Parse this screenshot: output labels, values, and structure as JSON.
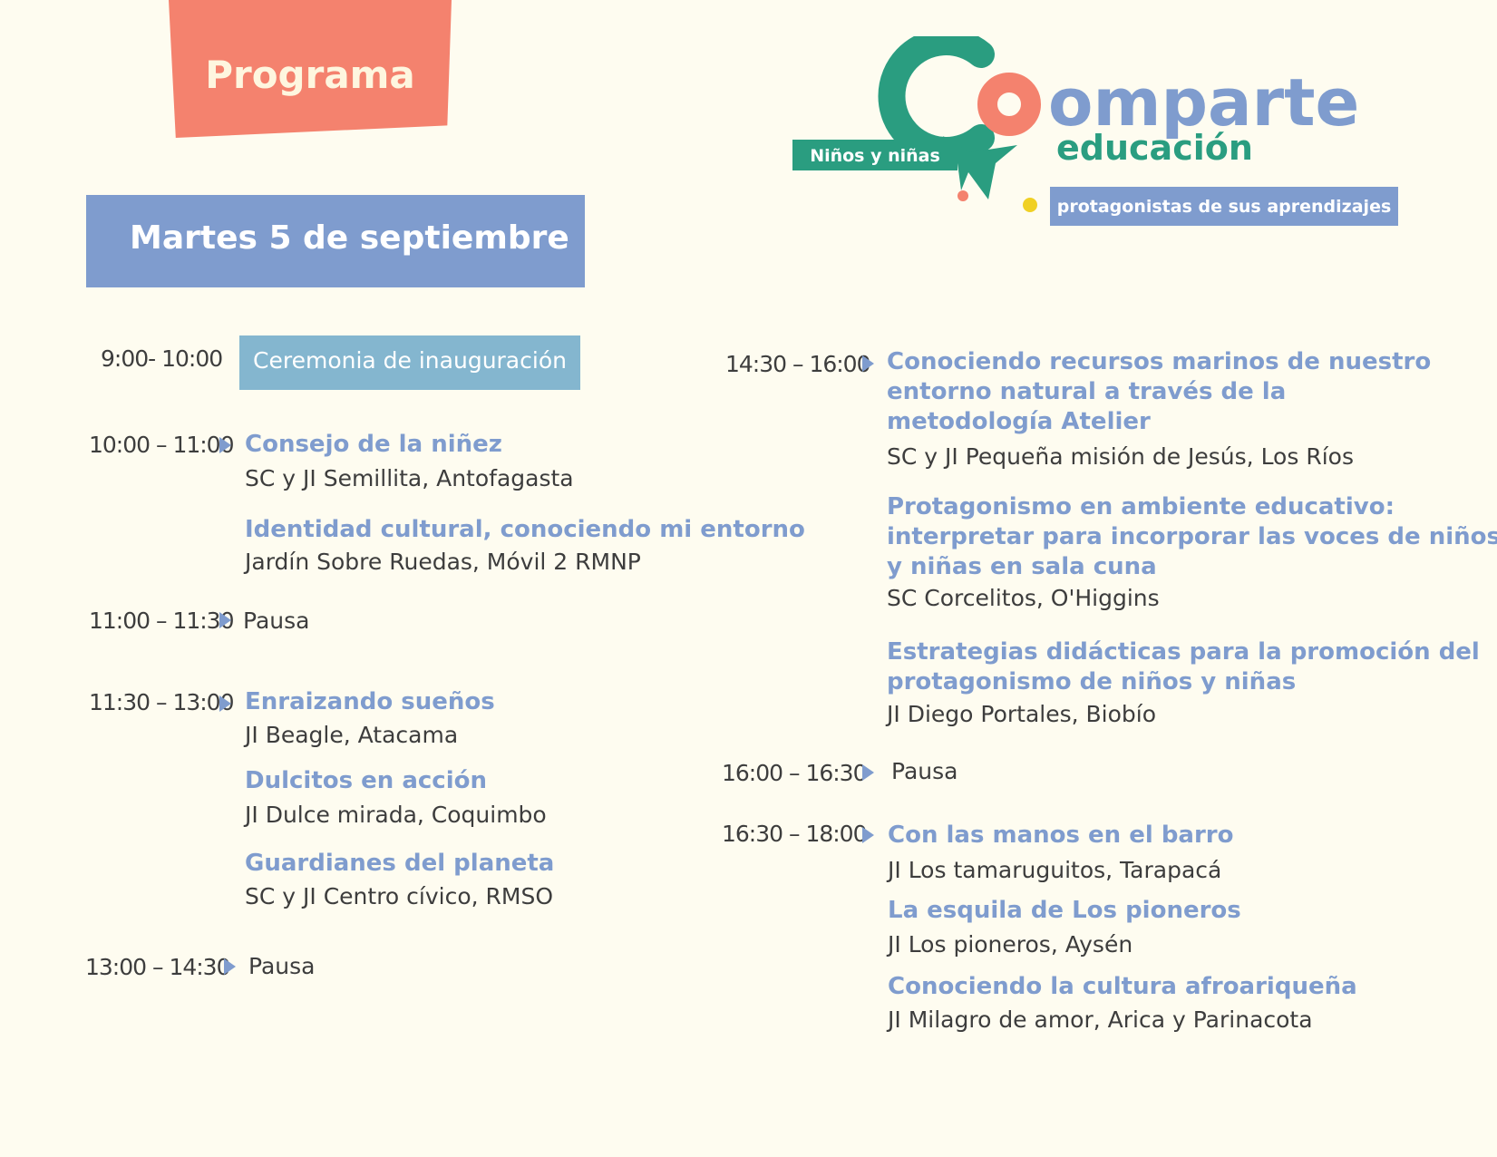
{
  "header": {
    "programa": "Programa",
    "date": "Martes 5 de septiembre"
  },
  "logo": {
    "word_main": "omparte",
    "letter_c": "C",
    "word_educacion": "educación",
    "tag_left": "Niños y niñas",
    "tag_right": "protagonistas de sus aprendizajes",
    "colors": {
      "teal": "#2a9d80",
      "coral": "#f4826e",
      "blue": "#7f9cce",
      "yellow": "#f0d024"
    }
  },
  "schedule_left": {
    "s1": {
      "time": "9:00- 10:00",
      "title": "Ceremonia de inauguración"
    },
    "s2": {
      "time": "10:00 – 11:00",
      "items": [
        {
          "title": "Consejo de la niñez",
          "sub": "SC y JI Semillita, Antofagasta"
        },
        {
          "title": "Identidad cultural, conociendo mi entorno",
          "sub": "Jardín Sobre Ruedas, Móvil 2 RMNP"
        }
      ]
    },
    "s3": {
      "time": "11:00 – 11:30",
      "label": "Pausa"
    },
    "s4": {
      "time": "11:30 – 13:00",
      "items": [
        {
          "title": "Enraizando sueños",
          "sub": "JI Beagle, Atacama"
        },
        {
          "title": "Dulcitos en acción",
          "sub": "JI Dulce mirada, Coquimbo"
        },
        {
          "title": "Guardianes del planeta",
          "sub": "SC y JI Centro cívico, RMSO"
        }
      ]
    },
    "s5": {
      "time": "13:00 – 14:30",
      "label": "Pausa"
    }
  },
  "schedule_right": {
    "s1": {
      "time": "14:30 – 16:00",
      "items": [
        {
          "title_lines": [
            "Conociendo recursos marinos de nuestro",
            "entorno natural a través de la",
            "metodología Atelier"
          ],
          "sub": "SC y JI Pequeña misión de Jesús, Los Ríos"
        },
        {
          "title_lines": [
            "Protagonismo en ambiente educativo:",
            "interpretar para incorporar las voces de niños",
            "y niñas en sala cuna"
          ],
          "sub": "SC Corcelitos, O'Higgins"
        },
        {
          "title_lines": [
            "Estrategias didácticas para la promoción del",
            "protagonismo de niños y niñas"
          ],
          "sub": "JI Diego Portales, Biobío"
        }
      ]
    },
    "s2": {
      "time": "16:00 – 16:30",
      "label": "Pausa"
    },
    "s3": {
      "time": "16:30 – 18:00",
      "items": [
        {
          "title": "Con las manos en el barro",
          "sub": "JI Los tamaruguitos, Tarapacá"
        },
        {
          "title": "La esquila de Los pioneros",
          "sub": "JI Los pioneros, Aysén"
        },
        {
          "title": "Conociendo la cultura afroariqueña",
          "sub": "JI Milagro de amor, Arica y Parinacota"
        }
      ]
    }
  }
}
